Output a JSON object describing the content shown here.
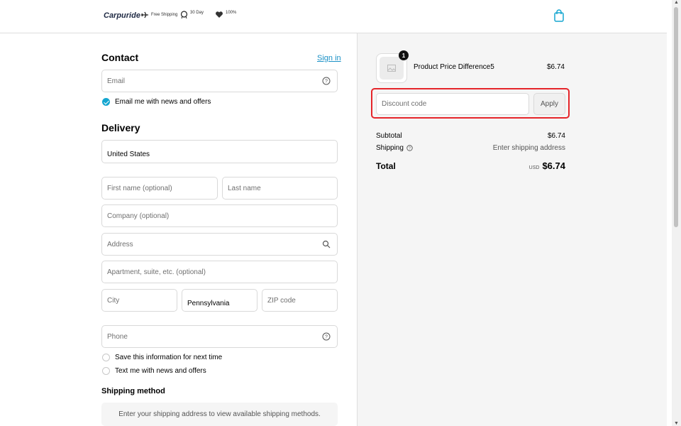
{
  "header": {
    "logo": "Carpuride",
    "badges": [
      {
        "icon": "airplane-icon",
        "text": "Free Shipping"
      },
      {
        "icon": "thirty-day-return-icon",
        "text": "30 Day"
      },
      {
        "icon": "heart-guarantee-icon",
        "text": "100%"
      }
    ],
    "cart_icon": "shopping-bag-icon"
  },
  "contact": {
    "title": "Contact",
    "sign_in": "Sign in",
    "email_placeholder": "Email",
    "news_offers_label": "Email me with news and offers",
    "news_offers_checked": true
  },
  "delivery": {
    "title": "Delivery",
    "country": "United States",
    "first_name_placeholder": "First name (optional)",
    "last_name_placeholder": "Last name",
    "company_placeholder": "Company (optional)",
    "address_placeholder": "Address",
    "apartment_placeholder": "Apartment, suite, etc. (optional)",
    "city_placeholder": "City",
    "state": "Pennsylvania",
    "zip_placeholder": "ZIP code",
    "phone_placeholder": "Phone",
    "save_info_label": "Save this information for next time",
    "text_news_label": "Text me with news and offers"
  },
  "shipping": {
    "title": "Shipping method",
    "message": "Enter your shipping address to view available shipping methods."
  },
  "summary": {
    "product": {
      "name": "Product Price Difference5",
      "price": "$6.74",
      "quantity": "1"
    },
    "discount_placeholder": "Discount code",
    "apply_label": "Apply",
    "subtotal_label": "Subtotal",
    "subtotal_value": "$6.74",
    "shipping_label": "Shipping",
    "shipping_value": "Enter shipping address",
    "total_label": "Total",
    "total_currency": "USD",
    "total_value": "$6.74"
  },
  "colors": {
    "accent": "#15a6d0",
    "link": "#1990c6",
    "highlight": "#e5252a"
  }
}
